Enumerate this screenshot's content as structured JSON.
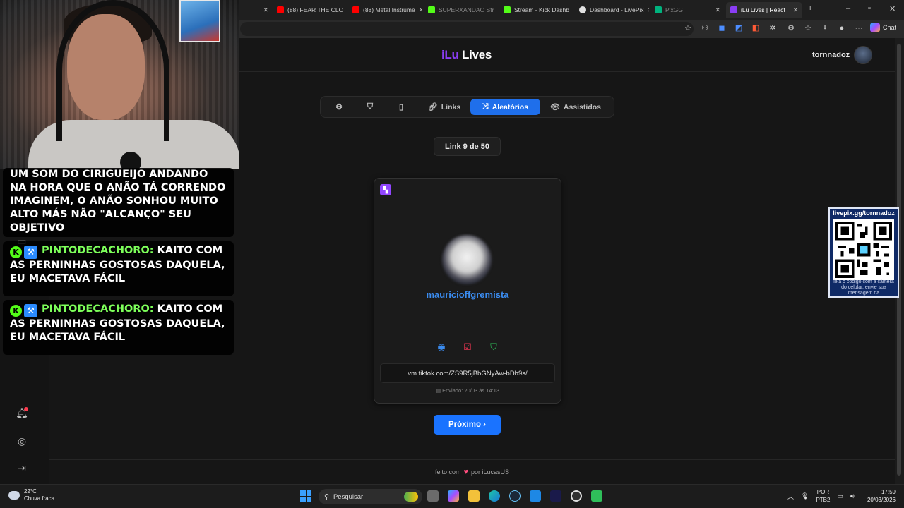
{
  "browser": {
    "tabs": [
      {
        "label": "(88) FEAR THE CLO",
        "fav": "#ff0000"
      },
      {
        "label": "(88) Metal Instrume",
        "fav": "#ff0000"
      },
      {
        "label": "SUPERXANDAO Str",
        "fav": "#53fc18"
      },
      {
        "label": "Stream - Kick Dashb",
        "fav": "#53fc18"
      },
      {
        "label": "Dashboard - LivePix",
        "fav": "#e0e0e0"
      },
      {
        "label": "PixGG",
        "fav": "#00b37e"
      },
      {
        "label": "iLu Lives | React",
        "fav": "#8a3df5"
      }
    ],
    "chat_label": "Chat"
  },
  "app": {
    "brand_a": "iLu",
    "brand_b": "Lives",
    "username": "tornnadoz",
    "nav": {
      "links": "Links",
      "random": "Aleatórios",
      "watched": "Assistidos"
    },
    "counter": "Link 9 de 50",
    "card": {
      "platform": "twitch",
      "name": "mauricioffgremista",
      "link": "vm.tiktok.com/ZS9R5jBbGNyAw-bDb9s/",
      "sent": "Enviado: 20/03 às 14:13"
    },
    "next_label": "Próximo ›",
    "footer_a": "feito com",
    "footer_heart": "♥",
    "footer_b": "por iLucasUS"
  },
  "overlay": {
    "chat": [
      {
        "user": "",
        "text": "UM SOM DO CIRIGUEIJO ANDANDO NA HORA QUE O ANÃO TÁ CORRENDO IMAGINEM, O ANÃO SONHOU MUITO ALTO MÁS NÃO \"ALCANÇO\" SEU OBJETIVO"
      },
      {
        "user": "PINTODECACHORO:",
        "text": "KAITO COM AS PERNINHAS GOSTOSAS DAQUELA, EU MACETAVA FÁCIL"
      },
      {
        "user": "PINTODECACHORO:",
        "text": "KAITO COM AS PERNINHAS GOSTOSAS DAQUELA, EU MACETAVA FÁCIL"
      }
    ],
    "qr_title": "livepix.gg/tornnadoz",
    "qr_caption": "leia o código com a câmera do celular. envie sua mensagem na"
  },
  "taskbar": {
    "weather_temp": "22°C",
    "weather_desc": "Chuva fraca",
    "search_placeholder": "Pesquisar",
    "lang": "POR",
    "layout": "PTB2",
    "time": "17:59",
    "date": "20/03/2026"
  }
}
